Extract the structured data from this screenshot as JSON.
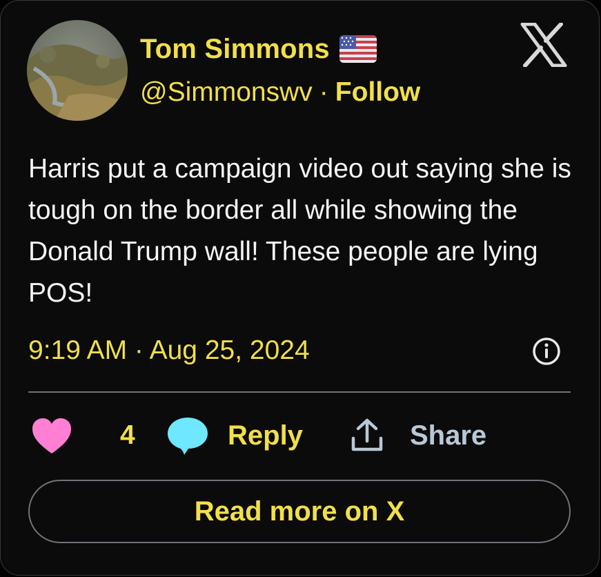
{
  "author": {
    "name": "Tom Simmons",
    "handle": "@Simmonswv",
    "separator": "·",
    "follow_label": "Follow",
    "flag_icon": "us-flag-icon"
  },
  "tweet": {
    "text": "Harris put a campaign video out saying she is tough on the border all while showing the Donald Trump wall! These people are lying POS!",
    "timestamp": "9:19 AM · Aug 25, 2024"
  },
  "actions": {
    "like_count": "4",
    "reply_label": "Reply",
    "share_label": "Share"
  },
  "footer": {
    "read_more_label": "Read more on X"
  },
  "colors": {
    "accent_yellow": "#f2df4a",
    "heart_pink": "#ff7fd4",
    "reply_cyan": "#6ee7ff",
    "share_blue": "#b9c8d6",
    "background": "#0b0b0b"
  },
  "icons": [
    "avatar",
    "us-flag-icon",
    "x-logo-icon",
    "info-icon",
    "heart-icon",
    "reply-bubble-icon",
    "share-icon"
  ]
}
